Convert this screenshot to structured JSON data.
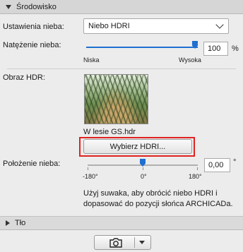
{
  "environment": {
    "section_title": "Środowisko",
    "sky_settings_label": "Ustawienia nieba:",
    "sky_settings_value": "Niebo HDRI",
    "sky_intensity_label": "Natężenie nieba:",
    "sky_intensity_value": "100",
    "sky_intensity_unit": "%",
    "sky_intensity_level": 1.0,
    "sky_intensity_min_label": "Niska",
    "sky_intensity_max_label": "Wysoka",
    "hdr_image_label": "Obraz HDR:",
    "hdr_filename": "W lesie GS.hdr",
    "choose_hdri_button": "Wybierz HDRI...",
    "sky_position_label": "Położenie nieba:",
    "sky_position_value": "0,00",
    "sky_position_unit": "°",
    "sky_position_ticks": [
      "-180°",
      "0°",
      "180°"
    ],
    "sky_position_level": 0.5,
    "hint_line1": "Użyj suwaka, aby obrócić niebo HDRI i",
    "hint_line2": "dopasować do pozycji słońca ARCHICADa."
  },
  "background": {
    "section_title": "Tło"
  },
  "toolbar": {
    "camera_icon": "camera-icon",
    "dropdown_icon": "chevron-down-icon"
  },
  "colors": {
    "accent": "#1f6fd1",
    "highlight": "#e0231f"
  }
}
